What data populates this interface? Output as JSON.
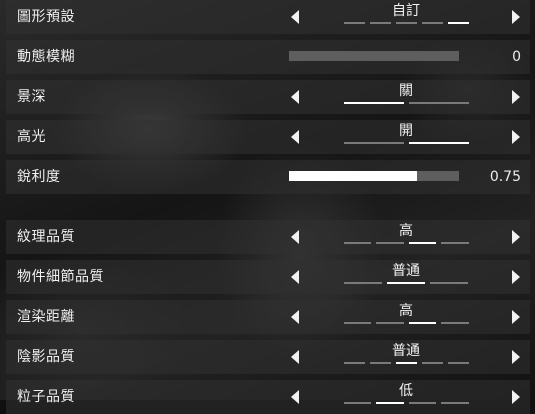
{
  "rows": [
    {
      "type": "option",
      "label": "圖形預設",
      "value": "自訂",
      "segments": 5,
      "active": 4
    },
    {
      "type": "slider",
      "label": "動態模糊",
      "fraction": 0,
      "display": "0"
    },
    {
      "type": "option",
      "label": "景深",
      "value": "關",
      "segments": 2,
      "active": 0
    },
    {
      "type": "option",
      "label": "高光",
      "value": "開",
      "segments": 2,
      "active": 1
    },
    {
      "type": "slider",
      "label": "銳利度",
      "fraction": 0.75,
      "display": "0.75"
    },
    {
      "type": "option",
      "label": "紋理品質",
      "value": "高",
      "segments": 4,
      "active": 2
    },
    {
      "type": "option",
      "label": "物件細節品質",
      "value": "普通",
      "segments": 3,
      "active": 1
    },
    {
      "type": "option",
      "label": "渲染距離",
      "value": "高",
      "segments": 4,
      "active": 2
    },
    {
      "type": "option",
      "label": "陰影品質",
      "value": "普通",
      "segments": 5,
      "active": 2
    },
    {
      "type": "option",
      "label": "粒子品質",
      "value": "低",
      "segments": 4,
      "active": 1
    }
  ]
}
